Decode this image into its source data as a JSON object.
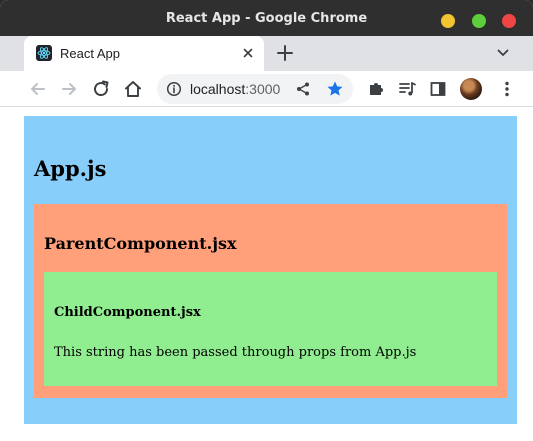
{
  "window": {
    "title": "React App - Google Chrome"
  },
  "tabs": [
    {
      "label": "React App",
      "favicon": "react-logo-icon",
      "active": true
    }
  ],
  "toolbar": {
    "url_host": "localhost",
    "url_port": ":3000",
    "icons": [
      "back-arrow-icon",
      "forward-arrow-icon",
      "reload-icon",
      "home-icon",
      "info-icon",
      "share-icon",
      "bookmark-star-icon",
      "extensions-icon",
      "media-queue-icon",
      "side-panel-icon",
      "profile-avatar",
      "kebab-menu-icon"
    ],
    "star_color": "#1a73e8"
  },
  "page": {
    "app_heading": "App.js",
    "parent_heading": "ParentComponent.jsx",
    "child_heading": "ChildComponent.jsx",
    "child_text": "This string has been passed through props from App.js",
    "colors": {
      "app_bg": "#87cefa",
      "parent_bg": "#ffa07a",
      "child_bg": "#90ee90"
    }
  }
}
